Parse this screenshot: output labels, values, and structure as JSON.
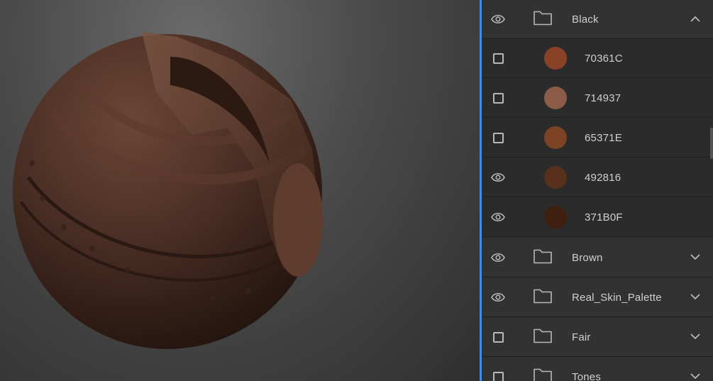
{
  "viewport": {
    "object": "sculpt-sphere"
  },
  "palette_panel": {
    "folders": [
      {
        "name": "Black",
        "expanded": true,
        "visibility": "eye-icon"
      },
      {
        "name": "Brown",
        "expanded": false,
        "visibility": "eye-icon"
      },
      {
        "name": "Real_Skin_Palette",
        "expanded": false,
        "visibility": "eye-icon"
      },
      {
        "name": "Fair",
        "expanded": false,
        "visibility": "checkbox"
      },
      {
        "name": "Tones",
        "expanded": false,
        "visibility": "checkbox"
      }
    ],
    "black_swatches": [
      {
        "hex": "70361C",
        "color": "#8a4226",
        "visibility": "checkbox"
      },
      {
        "hex": "714937",
        "color": "#8c5c48",
        "visibility": "checkbox"
      },
      {
        "hex": "65371E",
        "color": "#7c4424",
        "visibility": "checkbox"
      },
      {
        "hex": "492816",
        "color": "#59301b",
        "visibility": "eye-icon"
      },
      {
        "hex": "371B0F",
        "color": "#3f1f10",
        "visibility": "eye-icon"
      }
    ],
    "accent_color": "#3d8ee3"
  }
}
